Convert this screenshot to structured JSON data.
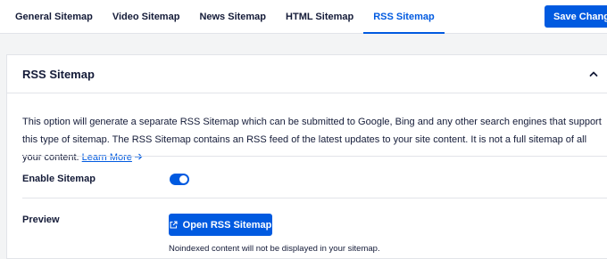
{
  "tabs": [
    {
      "label": "General Sitemap",
      "active": false
    },
    {
      "label": "Video Sitemap",
      "active": false
    },
    {
      "label": "News Sitemap",
      "active": false
    },
    {
      "label": "HTML Sitemap",
      "active": false
    },
    {
      "label": "RSS Sitemap",
      "active": true
    }
  ],
  "toolbar": {
    "save_label": "Save Changes"
  },
  "card": {
    "title": "RSS Sitemap",
    "collapse_icon": "chevron-up-icon",
    "description": "This option will generate a separate RSS Sitemap which can be submitted to Google, Bing and any other search engines that support this type of sitemap. The RSS Sitemap contains an RSS feed of the latest updates to your site content. It is not a full sitemap of all your content.",
    "learn_more_label": "Learn More",
    "learn_more_icon": "arrow-right-icon"
  },
  "settings": {
    "enable_label": "Enable Sitemap",
    "enable_value": true,
    "preview_label": "Preview",
    "open_button_label": "Open RSS Sitemap",
    "open_button_icon": "external-link-icon",
    "note": "Noindexed content will not be displayed in your sitemap."
  },
  "colors": {
    "accent": "#005ae0",
    "text": "#141b38",
    "background": "#f3f4f5",
    "border": "#e2e4e9"
  }
}
